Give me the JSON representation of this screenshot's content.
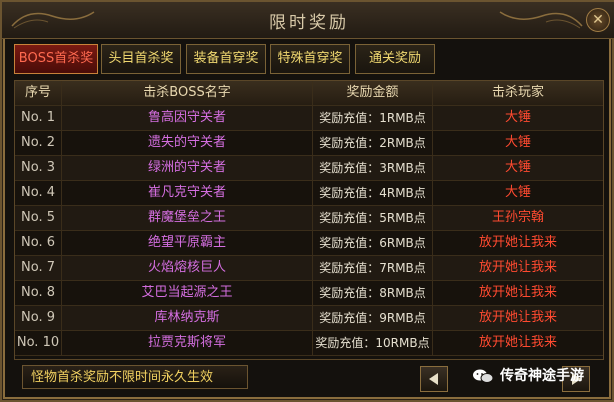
{
  "window": {
    "title": "限时奖励",
    "close_glyph": "✕"
  },
  "tabs": [
    {
      "label": "BOSS首杀奖",
      "active": true
    },
    {
      "label": "头目首杀奖",
      "active": false
    },
    {
      "label": "装备首穿奖",
      "active": false
    },
    {
      "label": "特殊首穿奖",
      "active": false
    },
    {
      "label": "通关奖励",
      "active": false
    }
  ],
  "table": {
    "headers": {
      "index": "序号",
      "boss": "击杀BOSS名字",
      "reward": "奖励金额",
      "player": "击杀玩家"
    },
    "rows": [
      {
        "index": "No. 1",
        "boss": "鲁高因守关者",
        "reward": "奖励充值：1RMB点",
        "player": "大锤"
      },
      {
        "index": "No. 2",
        "boss": "遗失的守关者",
        "reward": "奖励充值：2RMB点",
        "player": "大锤"
      },
      {
        "index": "No. 3",
        "boss": "绿洲的守关者",
        "reward": "奖励充值：3RMB点",
        "player": "大锤"
      },
      {
        "index": "No. 4",
        "boss": "崔凡克守关者",
        "reward": "奖励充值：4RMB点",
        "player": "大锤"
      },
      {
        "index": "No. 5",
        "boss": "群魔堡垒之王",
        "reward": "奖励充值：5RMB点",
        "player": "王孙宗翰"
      },
      {
        "index": "No. 6",
        "boss": "绝望平原霸主",
        "reward": "奖励充值：6RMB点",
        "player": "放开她让我来"
      },
      {
        "index": "No. 7",
        "boss": "火焰熔核巨人",
        "reward": "奖励充值：7RMB点",
        "player": "放开她让我来"
      },
      {
        "index": "No. 8",
        "boss": "艾巴当起源之王",
        "reward": "奖励充值：8RMB点",
        "player": "放开她让我来"
      },
      {
        "index": "No. 9",
        "boss": "库林纳克斯",
        "reward": "奖励充值：9RMB点",
        "player": "放开她让我来"
      },
      {
        "index": "No. 10",
        "boss": "拉贾克斯将军",
        "reward": "奖励充值：10RMB点",
        "player": "放开她让我来"
      }
    ]
  },
  "footer": {
    "note": "怪物首杀奖励不限时间永久生效"
  },
  "watermark": {
    "text": "传奇神途手游",
    "icon": "wechat-icon"
  },
  "colors": {
    "boss_name": "#d46ee0",
    "player": "#ff4a30",
    "tab_text": "#f0d870",
    "frame_gold": "#8a6d3d"
  }
}
